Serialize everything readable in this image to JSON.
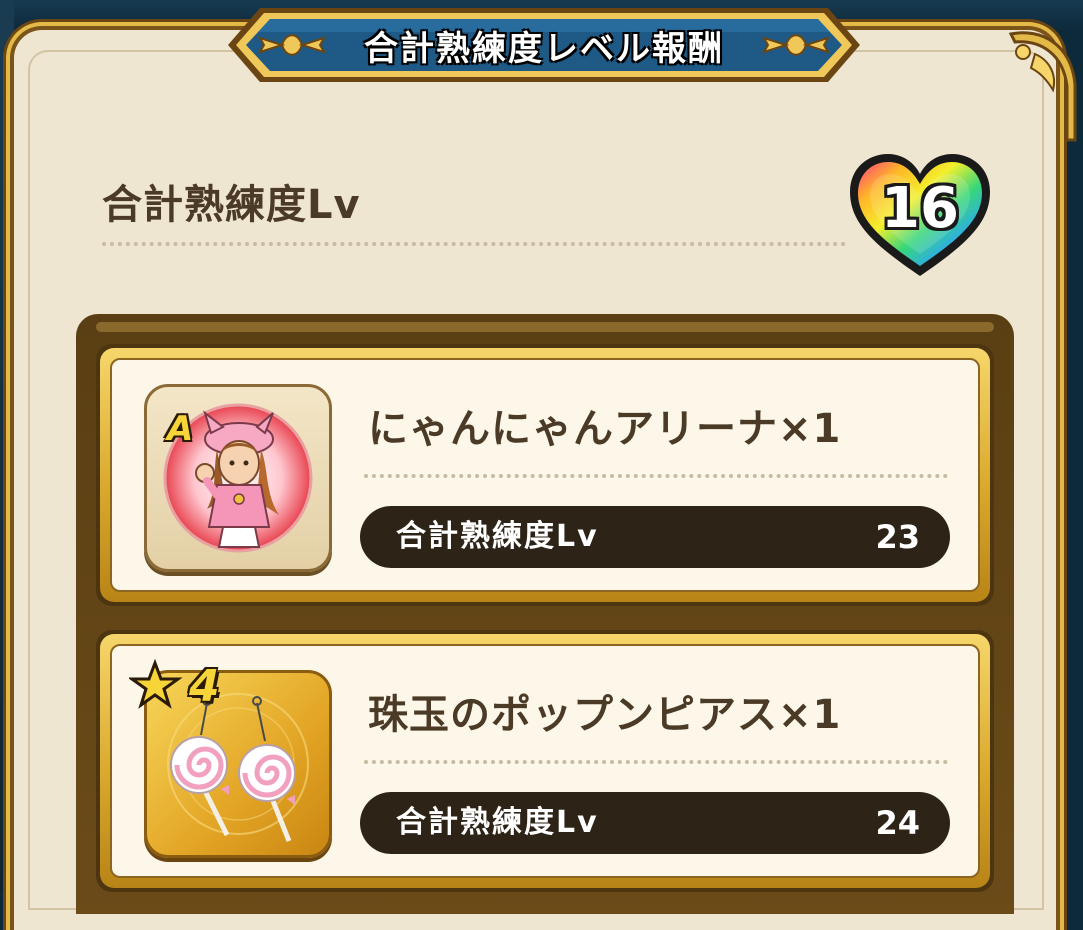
{
  "header": {
    "title": "合計熟練度レベル報酬"
  },
  "summary": {
    "label": "合計熟練度Lv",
    "level": "16"
  },
  "rewards": [
    {
      "name": "にゃんにゃんアリーナ×1",
      "badge": "A",
      "badge_type": "rank",
      "icon": "cat-girl-outfit-icon",
      "requirement_label": "合計熟練度Lv",
      "requirement_value": "23"
    },
    {
      "name": "珠玉のポップンピアス×1",
      "badge": "4",
      "badge_type": "star",
      "icon": "lollipop-earrings-icon",
      "requirement_label": "合計熟練度Lv",
      "requirement_value": "24"
    }
  ],
  "colors": {
    "parchment": "#efe6d1",
    "frame_gold": "#e3b948",
    "text_brown": "#4a3a26",
    "pill_dark": "#2d2417",
    "banner_blue": "#1f5a86"
  }
}
